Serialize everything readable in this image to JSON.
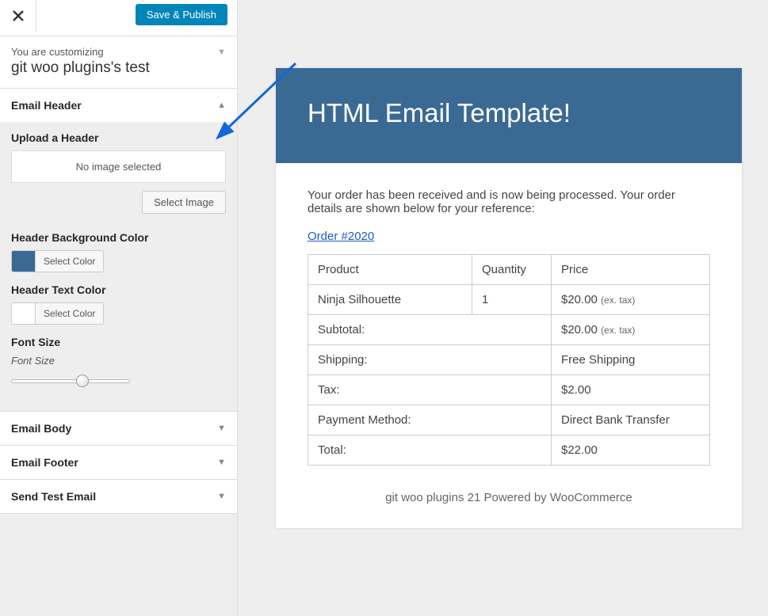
{
  "topbar": {
    "save_publish": "Save & Publish"
  },
  "customizing": {
    "label": "You are customizing",
    "site": "git woo plugins's test"
  },
  "sections": {
    "email_header": "Email Header",
    "email_body": "Email Body",
    "email_footer": "Email Footer",
    "send_test": "Send Test Email"
  },
  "header_panel": {
    "upload_label": "Upload a Header",
    "no_image": "No image selected",
    "select_image": "Select Image",
    "bg_color_label": "Header Background Color",
    "bg_color": "#3a6a94",
    "text_color_label": "Header Text Color",
    "text_color": "#ffffff",
    "select_color": "Select Color",
    "font_size_label": "Font Size",
    "font_size_text": "Font Size"
  },
  "preview": {
    "title": "HTML Email Template!",
    "intro": "Your order has been received and is now being processed. Your order details are shown below for your reference:",
    "order_link": "Order #2020",
    "columns": {
      "product": "Product",
      "quantity": "Quantity",
      "price": "Price"
    },
    "items": [
      {
        "product": "Ninja Silhouette",
        "quantity": "1",
        "price": "$20.00",
        "price_note": "(ex. tax)"
      }
    ],
    "summary": [
      {
        "label": "Subtotal:",
        "value": "$20.00",
        "note": "(ex. tax)"
      },
      {
        "label": "Shipping:",
        "value": "Free Shipping",
        "note": ""
      },
      {
        "label": "Tax:",
        "value": "$2.00",
        "note": ""
      },
      {
        "label": "Payment Method:",
        "value": "Direct Bank Transfer",
        "note": ""
      },
      {
        "label": "Total:",
        "value": "$22.00",
        "note": ""
      }
    ],
    "footer": "git woo plugins 21 Powered by WooCommerce"
  }
}
